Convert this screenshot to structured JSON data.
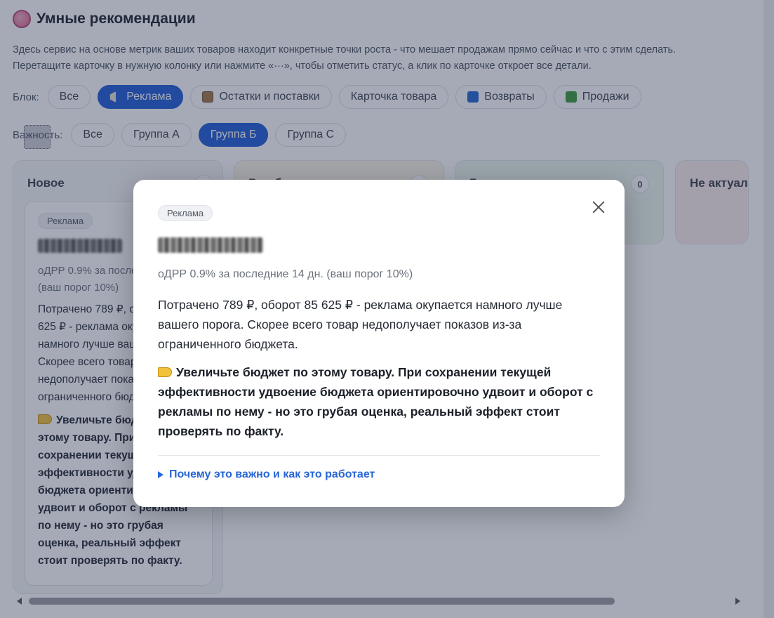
{
  "header": {
    "title": "Умные рекомендации",
    "icon": "brain-icon"
  },
  "description": [
    "Здесь сервис на основе метрик ваших товаров находит конкретные точки роста - что мешает продажам прямо сейчас и что с этим сделать.",
    "Перетащите карточку в нужную колонку или нажмите «···», чтобы отметить статус, а клик по карточке откроет все детали."
  ],
  "filters": {
    "block_label": "Блок:",
    "blocks": [
      {
        "label": "Все",
        "icon": ""
      },
      {
        "label": "Реклама",
        "icon": "megaphone-icon",
        "active": true
      },
      {
        "label": "Остатки и поставки",
        "icon": "box-icon"
      },
      {
        "label": "Карточка товара",
        "icon": "card-icon"
      },
      {
        "label": "Возвраты",
        "icon": "return-icon"
      },
      {
        "label": "Продажи",
        "icon": "chart-icon"
      }
    ],
    "importance_label": "Важность:",
    "importance": [
      {
        "label": "Все"
      },
      {
        "label": "Группа А"
      },
      {
        "label": "Группа Б",
        "active": true
      },
      {
        "label": "Группа С"
      }
    ]
  },
  "columns": [
    {
      "title": "Новое",
      "count": "1"
    },
    {
      "title": "В работе",
      "count": "0"
    },
    {
      "title": "Готово",
      "count": "0"
    },
    {
      "title": "Не актуал"
    }
  ],
  "card": {
    "tag": "Реклама",
    "metric": "оДРР 0.9% за последние 14 дн. (ваш порог 10%)",
    "body": "Потрачено 789 ₽, оборот 85 625 ₽ - реклама окупается намного лучше вашего порога. Скорее всего товар недополучает показов из-за ограниченного бюджета.",
    "action": "Увеличьте бюджет по этому товару. При сохранении текущей эффективности удвоение бюджета ориентировочно удвоит и оборот с рекламы по нему - но это грубая оценка, реальный эффект стоит проверять по факту."
  },
  "modal": {
    "tag": "Реклама",
    "metric": "оДРР 0.9% за последние 14 дн. (ваш порог 10%)",
    "body": "Потрачено 789 ₽, оборот 85 625 ₽ - реклама окупается намного лучше вашего порога. Скорее всего товар недополучает показов из-за ограниченного бюджета.",
    "action": "Увеличьте бюджет по этому товару. При сохранении текущей эффективности удвоение бюджета ориентировочно удвоит и оборот с рекламы по нему - но это грубая оценка, реальный эффект стоит проверять по факту.",
    "details_link": "Почему это важно и как это работает"
  },
  "colors": {
    "accent": "#1e5bd6",
    "link": "#2766d6",
    "overlay": "rgba(40,52,82,0.42)"
  }
}
